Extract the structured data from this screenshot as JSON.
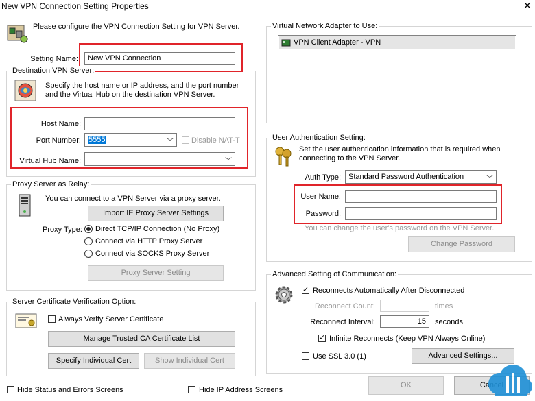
{
  "window": {
    "title": "New VPN Connection Setting Properties",
    "close_glyph": "✕"
  },
  "intro": "Please configure the VPN Connection Setting for VPN Server.",
  "setting_name": {
    "label": "Setting Name:",
    "value": "New VPN Connection"
  },
  "destination": {
    "title": "Destination VPN Server:",
    "desc1": "Specify the host name or IP address, and the port number",
    "desc2": "and the Virtual Hub on the destination VPN Server.",
    "host_label": "Host Name:",
    "host_value": "",
    "port_label": "Port Number:",
    "port_value": "5555",
    "nat_label": "Disable NAT-T",
    "hub_label": "Virtual Hub Name:",
    "hub_value": ""
  },
  "proxy": {
    "title": "Proxy Server as Relay:",
    "desc": "You can connect to a VPN Server via a proxy server.",
    "import_button": "Import IE Proxy Server Settings",
    "type_label": "Proxy Type:",
    "options": [
      "Direct TCP/IP Connection (No Proxy)",
      "Connect via HTTP Proxy Server",
      "Connect via SOCKS Proxy Server"
    ],
    "setting_button": "Proxy Server Setting"
  },
  "cert": {
    "title": "Server Certificate Verification Option:",
    "always_verify": "Always Verify Server Certificate",
    "manage_button": "Manage Trusted CA Certificate List",
    "specify_button": "Specify Individual Cert",
    "show_button": "Show Individual Cert"
  },
  "bottom": {
    "hide_status": "Hide Status and Errors Screens",
    "hide_ip": "Hide IP Address Screens",
    "ok": "OK",
    "cancel": "Cancel"
  },
  "adapter": {
    "title": "Virtual Network Adapter to Use:",
    "items": [
      "VPN Client Adapter - VPN"
    ]
  },
  "auth": {
    "title": "User Authentication Setting:",
    "desc1": "Set the user authentication information that is required when",
    "desc2": "connecting to the VPN Server.",
    "type_label": "Auth Type:",
    "type_value": "Standard Password Authentication",
    "user_label": "User Name:",
    "user_value": "",
    "pass_label": "Password:",
    "pass_value": "",
    "hint": "You can change the user's password on the VPN Server.",
    "change_button": "Change Password"
  },
  "advanced": {
    "title": "Advanced Setting of Communication:",
    "reconnect_auto": "Reconnects Automatically After Disconnected",
    "count_label": "Reconnect Count:",
    "count_unit": "times",
    "interval_label": "Reconnect Interval:",
    "interval_value": "15",
    "interval_unit": "seconds",
    "infinite": "Infinite Reconnects (Keep VPN Always Online)",
    "ssl": "Use SSL 3.0 (1)",
    "settings_button": "Advanced Settings..."
  }
}
